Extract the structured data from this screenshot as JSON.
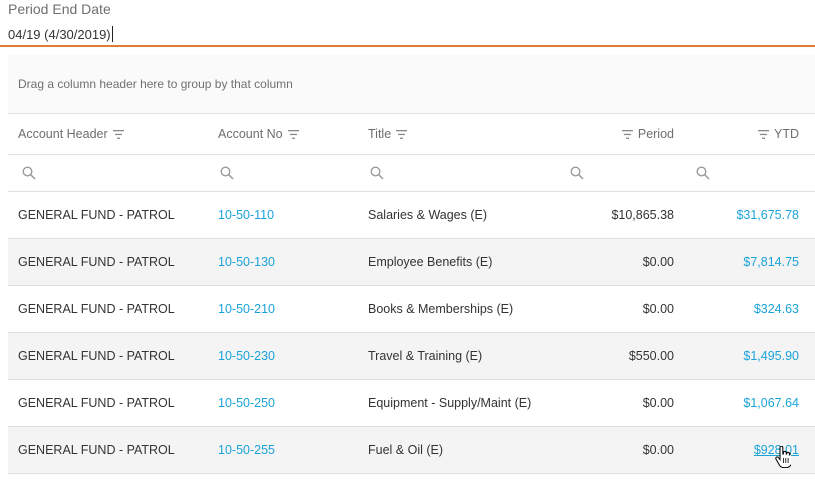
{
  "period": {
    "label": "Period End Date",
    "value": "04/19 (4/30/2019)"
  },
  "grid": {
    "group_hint": "Drag a column header here to group by that column",
    "columns": {
      "account_header": "Account Header",
      "account_no": "Account No",
      "title": "Title",
      "period": "Period",
      "ytd": "YTD"
    },
    "rows": [
      {
        "header": "GENERAL FUND - PATROL",
        "account_no": "10-50-110",
        "title": "Salaries & Wages (E)",
        "period": "$10,865.38",
        "ytd": "$31,675.78"
      },
      {
        "header": "GENERAL FUND - PATROL",
        "account_no": "10-50-130",
        "title": "Employee Benefits (E)",
        "period": "$0.00",
        "ytd": "$7,814.75"
      },
      {
        "header": "GENERAL FUND - PATROL",
        "account_no": "10-50-210",
        "title": "Books & Memberships (E)",
        "period": "$0.00",
        "ytd": "$324.63"
      },
      {
        "header": "GENERAL FUND - PATROL",
        "account_no": "10-50-230",
        "title": "Travel & Training (E)",
        "period": "$550.00",
        "ytd": "$1,495.90"
      },
      {
        "header": "GENERAL FUND - PATROL",
        "account_no": "10-50-250",
        "title": "Equipment - Supply/Maint (E)",
        "period": "$0.00",
        "ytd": "$1,067.64"
      },
      {
        "header": "GENERAL FUND - PATROL",
        "account_no": "10-50-255",
        "title": "Fuel & Oil (E)",
        "period": "$0.00",
        "ytd": "$928.01"
      }
    ]
  },
  "colors": {
    "accent": "#e17c37",
    "link": "#1aa3d9",
    "alt_row": "#f4f4f4"
  },
  "icons": [
    "filter-icon",
    "search-icon",
    "hand-pointer-cursor"
  ]
}
